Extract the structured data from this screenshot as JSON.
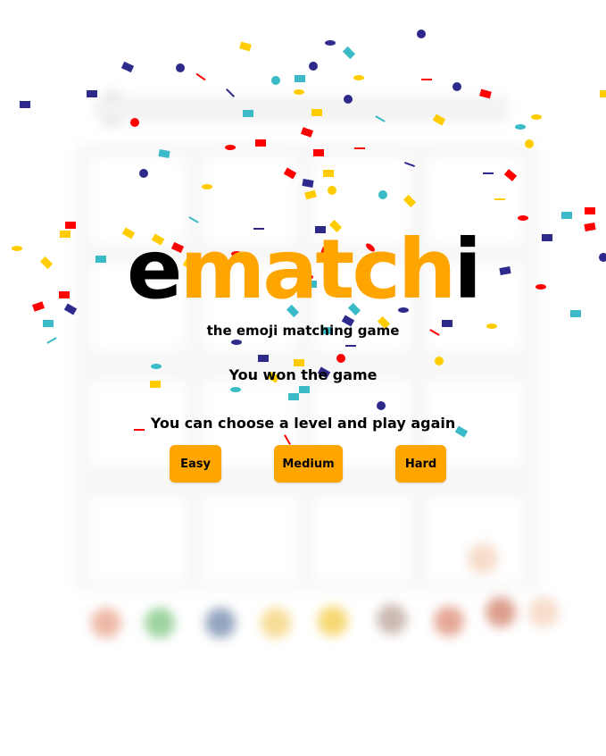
{
  "logo": {
    "first_letter": "e",
    "middle_letters": "match",
    "last_letter": "i",
    "colors": {
      "dark": "#000000",
      "accent": "#ffa500"
    }
  },
  "subtitle": "the emoji matching game",
  "result_message": "You won the game",
  "replay_prompt": "You can choose a level and play again",
  "levels": {
    "easy": "Easy",
    "medium": "Medium",
    "hard": "Hard"
  },
  "confetti_colors": [
    "#2e2a8c",
    "#ffcc00",
    "#ff0000",
    "#3bbac8"
  ],
  "background": {
    "state": "blurred game board",
    "emoji_colors": [
      "#e08060",
      "#4caf50",
      "#3a5a8a",
      "#f0c040",
      "#f0b800",
      "#a08070",
      "#d06040",
      "#c05030",
      "#f0c0a0"
    ]
  }
}
